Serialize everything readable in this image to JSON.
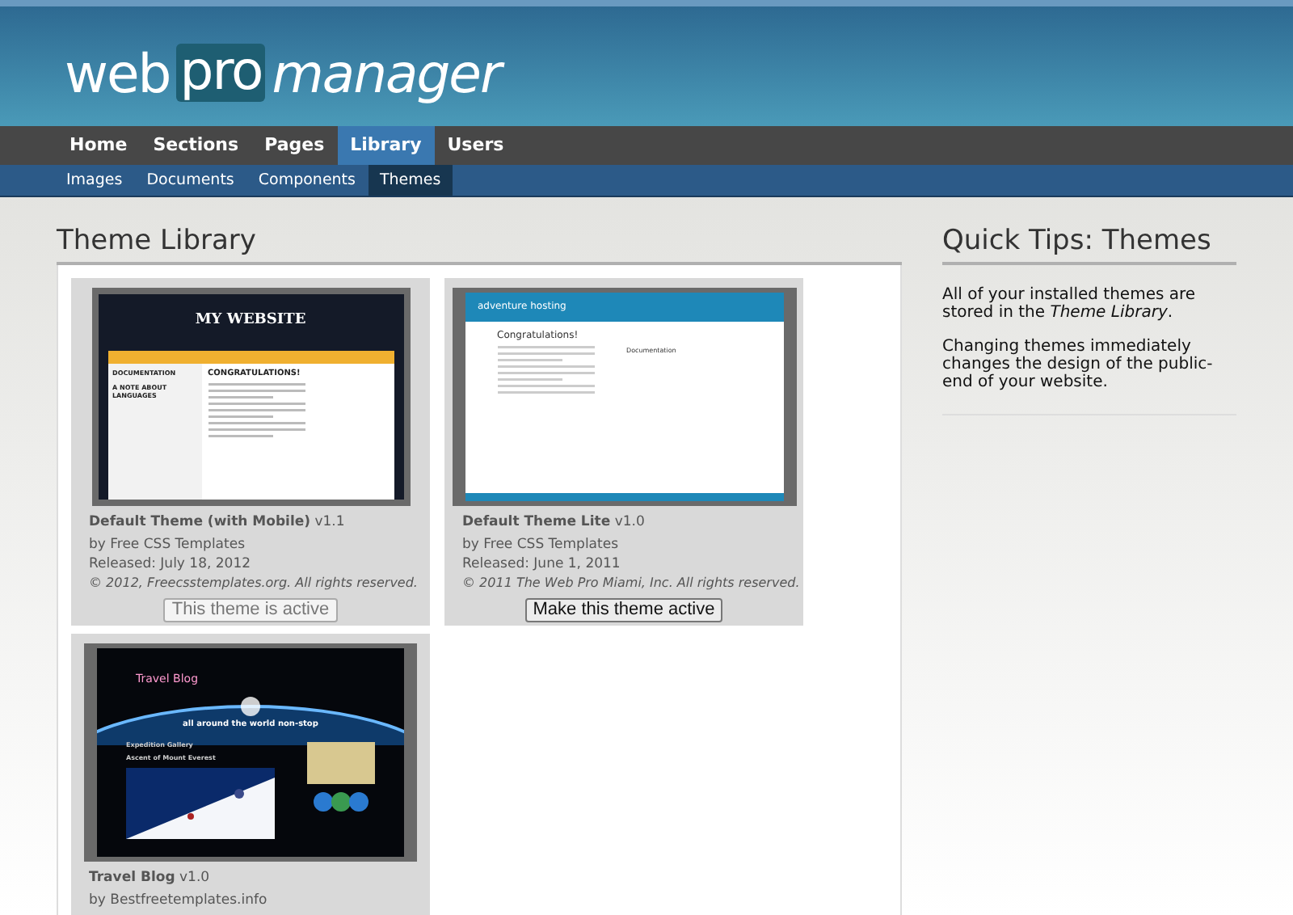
{
  "logo": {
    "part_1": "web",
    "part_2": "pro",
    "part_3": "manager"
  },
  "nav": [
    {
      "label": "Home",
      "selected": false
    },
    {
      "label": "Sections",
      "selected": false
    },
    {
      "label": "Pages",
      "selected": false
    },
    {
      "label": "Library",
      "selected": true
    },
    {
      "label": "Users",
      "selected": false
    }
  ],
  "subnav": [
    {
      "label": "Images",
      "selected": false
    },
    {
      "label": "Documents",
      "selected": false
    },
    {
      "label": "Components",
      "selected": false
    },
    {
      "label": "Themes",
      "selected": true
    }
  ],
  "main": {
    "title": "Theme Library",
    "themes": [
      {
        "kind": "classic",
        "preview": {
          "title": "MY WEBSITE",
          "heading": "CONGRATULATIONS!",
          "sidebar": [
            "DOCUMENTATION",
            "A NOTE ABOUT LANGUAGES"
          ]
        },
        "name": "Default Theme (with Mobile)",
        "version": "v1.1",
        "author": "by Free CSS Templates",
        "released": "Released: July 18, 2012",
        "copyright": "© 2012, Freecsstemplates.org. All rights reserved.",
        "button": "This theme is active",
        "active": true
      },
      {
        "kind": "hosting",
        "preview": {
          "title": "adventure hosting",
          "heading": "Congratulations!",
          "sidebar": [
            "Documentation"
          ]
        },
        "name": "Default Theme Lite",
        "version": "v1.0",
        "author": "by Free CSS Templates",
        "released": "Released: June 1, 2011",
        "copyright": "© 2011 The Web Pro Miami, Inc. All rights reserved.",
        "button": "Make this theme active",
        "active": false
      },
      {
        "kind": "travel",
        "preview": {
          "title": "Travel Blog",
          "heading": "all around the world non-stop",
          "sidebar": [
            "Expedition Gallery",
            "Ascent of Mount Everest"
          ]
        },
        "name": "Travel Blog",
        "version": "v1.0",
        "author": "by Bestfreetemplates.info"
      }
    ]
  },
  "tips": {
    "title": "Quick Tips: Themes",
    "paragraphs": [
      "All of your installed themes are stored in the *Theme Library*.",
      "Changing themes immediately changes the design of the public-end of your website."
    ]
  }
}
